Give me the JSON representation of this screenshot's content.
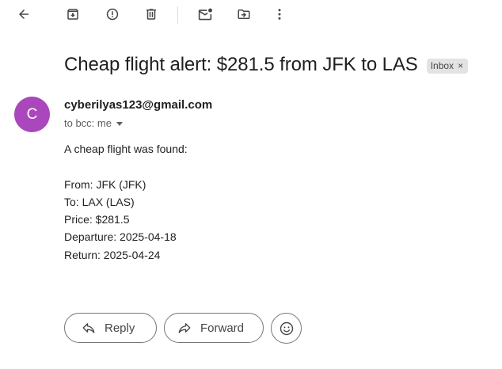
{
  "toolbar": {
    "icons": {
      "back": "arrow-back-icon",
      "archive": "archive-icon",
      "spam": "report-spam-icon",
      "delete": "delete-icon",
      "unread": "mark-unread-icon",
      "move": "move-to-icon",
      "more": "more-vert-icon"
    }
  },
  "message": {
    "subject": "Cheap flight alert: $281.5 from JFK to LAS",
    "label": "Inbox",
    "label_close": "×",
    "sender": {
      "avatar_letter": "C",
      "avatar_color": "#ab47bc",
      "email": "cyberilyas123@gmail.com"
    },
    "recipients": "to bcc: me",
    "body": {
      "intro": "A cheap flight was found:",
      "from": "From: JFK (JFK)",
      "to": "To: LAX (LAS)",
      "price": "Price: $281.5",
      "departure": "Departure: 2025-04-18",
      "return": "Return: 2025-04-24"
    }
  },
  "actions": {
    "reply_label": "Reply",
    "forward_label": "Forward",
    "emoji": "add-reaction-icon"
  }
}
